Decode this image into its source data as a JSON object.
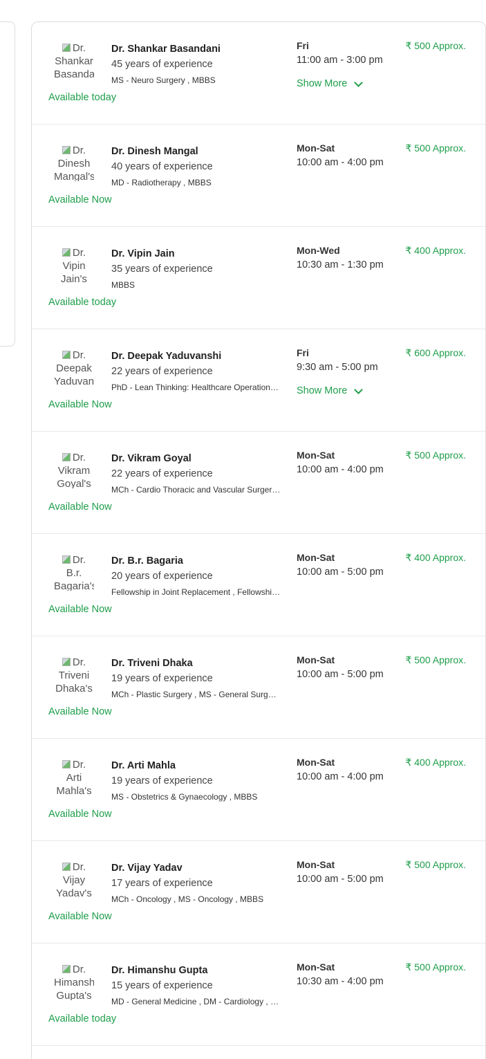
{
  "doctors": [
    {
      "img_alt": "Dr. Shankar Basandani's",
      "name": "Dr. Shankar Basandani",
      "experience": "45 years of experience",
      "qualification": "MS - Neuro Surgery , MBBS",
      "availability": "Available today",
      "days": "Fri",
      "hours": "11:00 am - 3:00 pm",
      "show_more": "Show More",
      "fee": "₹ 500 Approx."
    },
    {
      "img_alt": "Dr. Dinesh Mangal's",
      "name": "Dr. Dinesh Mangal",
      "experience": "40 years of experience",
      "qualification": "MD - Radiotherapy , MBBS",
      "availability": "Available Now",
      "days": "Mon-Sat",
      "hours": "10:00 am - 4:00 pm",
      "show_more": "",
      "fee": "₹ 500 Approx."
    },
    {
      "img_alt": "Dr. Vipin Jain's",
      "name": "Dr. Vipin Jain",
      "experience": "35 years of experience",
      "qualification": "MBBS",
      "availability": "Available today",
      "days": "Mon-Wed",
      "hours": "10:30 am - 1:30 pm",
      "show_more": "",
      "fee": "₹ 400 Approx."
    },
    {
      "img_alt": "Dr. Deepak Yaduvanshi's",
      "name": "Dr. Deepak Yaduvanshi",
      "experience": "22 years of experience",
      "qualification": "PhD - Lean Thinking: Healthcare Operations Management",
      "availability": "Available Now",
      "days": "Fri",
      "hours": "9:30 am - 5:00 pm",
      "show_more": "Show More",
      "fee": "₹ 600 Approx."
    },
    {
      "img_alt": "Dr. Vikram Goyal's",
      "name": "Dr. Vikram Goyal",
      "experience": "22 years of experience",
      "qualification": "MCh - Cardio Thoracic and Vascular Surgery , MBBS",
      "availability": "Available Now",
      "days": "Mon-Sat",
      "hours": "10:00 am - 4:00 pm",
      "show_more": "",
      "fee": "₹ 500 Approx."
    },
    {
      "img_alt": "Dr. B.r. Bagaria's",
      "name": "Dr. B.r. Bagaria",
      "experience": "20 years of experience",
      "qualification": "Fellowship in Joint Replacement , Fellowship in Arthroscopy",
      "availability": "Available Now",
      "days": "Mon-Sat",
      "hours": "10:00 am - 5:00 pm",
      "show_more": "",
      "fee": "₹ 400 Approx."
    },
    {
      "img_alt": "Dr. Triveni Dhaka's",
      "name": "Dr. Triveni Dhaka",
      "experience": "19 years of experience",
      "qualification": "MCh - Plastic Surgery , MS - General Surgery , MBBS",
      "availability": "Available Now",
      "days": "Mon-Sat",
      "hours": "10:00 am - 5:00 pm",
      "show_more": "",
      "fee": "₹ 500 Approx."
    },
    {
      "img_alt": "Dr. Arti Mahla's",
      "name": "Dr. Arti Mahla",
      "experience": "19 years of experience",
      "qualification": "MS - Obstetrics & Gynaecology , MBBS",
      "availability": "Available Now",
      "days": "Mon-Sat",
      "hours": "10:00 am - 4:00 pm",
      "show_more": "",
      "fee": "₹ 400 Approx."
    },
    {
      "img_alt": "Dr. Vijay Yadav's",
      "name": "Dr. Vijay Yadav",
      "experience": "17 years of experience",
      "qualification": "MCh - Oncology , MS - Oncology , MBBS",
      "availability": "Available Now",
      "days": "Mon-Sat",
      "hours": "10:00 am - 5:00 pm",
      "show_more": "",
      "fee": "₹ 500 Approx."
    },
    {
      "img_alt": "Dr. Himanshu Gupta's",
      "name": "Dr. Himanshu Gupta",
      "experience": "15 years of experience",
      "qualification": "MD - General Medicine , DM - Cardiology , MBBS",
      "availability": "Available today",
      "days": "Mon-Sat",
      "hours": "10:30 am - 4:00 pm",
      "show_more": "",
      "fee": "₹ 500 Approx."
    }
  ],
  "colors": {
    "accent_green": "#1e9e4a",
    "border": "#dcdcdc"
  }
}
